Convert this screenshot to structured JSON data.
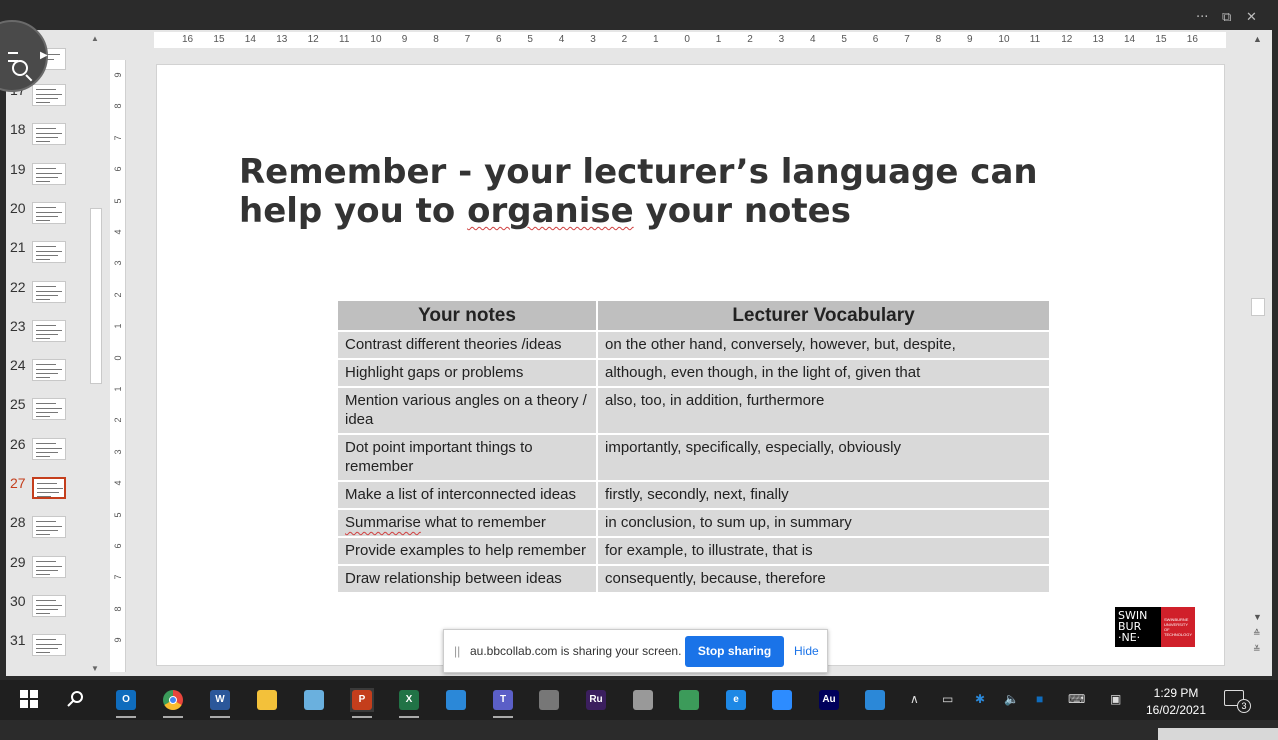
{
  "window": {
    "more": "···",
    "restore": "⧉",
    "close": "✕"
  },
  "thumbnails": [
    {
      "num": "17",
      "active": false
    },
    {
      "num": "18",
      "active": false
    },
    {
      "num": "19",
      "active": false
    },
    {
      "num": "20",
      "active": false
    },
    {
      "num": "21",
      "active": false
    },
    {
      "num": "22",
      "active": false
    },
    {
      "num": "23",
      "active": false
    },
    {
      "num": "24",
      "active": false
    },
    {
      "num": "25",
      "active": false
    },
    {
      "num": "26",
      "active": false
    },
    {
      "num": "27",
      "active": true
    },
    {
      "num": "28",
      "active": false
    },
    {
      "num": "29",
      "active": false
    },
    {
      "num": "30",
      "active": false
    },
    {
      "num": "31",
      "active": false
    }
  ],
  "ruler": {
    "horizontal": [
      "16",
      "15",
      "14",
      "13",
      "12",
      "11",
      "10",
      "9",
      "8",
      "7",
      "6",
      "5",
      "4",
      "3",
      "2",
      "1",
      "0",
      "1",
      "2",
      "3",
      "4",
      "5",
      "6",
      "7",
      "8",
      "9",
      "10",
      "11",
      "12",
      "13",
      "14",
      "15",
      "16"
    ],
    "vertical": [
      "9",
      "8",
      "7",
      "6",
      "5",
      "4",
      "3",
      "2",
      "1",
      "0",
      "1",
      "2",
      "3",
      "4",
      "5",
      "6",
      "7",
      "8",
      "9"
    ]
  },
  "slide": {
    "title_line1": "Remember - your lecturer’s language can",
    "title_line2_a": "help you to ",
    "title_line2_b": "organise",
    "title_line2_c": " your notes",
    "table": {
      "headers": [
        "Your notes",
        "Lecturer Vocabulary"
      ],
      "rows": [
        [
          "Contrast different theories /ideas",
          "on the other hand, conversely, however, but, despite,"
        ],
        [
          "Highlight gaps or problems",
          "although, even though, in the light of, given that"
        ],
        [
          "Mention various angles on a theory / idea",
          "also, too, in addition, furthermore"
        ],
        [
          "Dot point important things to remember",
          "importantly, specifically, especially, obviously"
        ],
        [
          "Make a list of interconnected ideas",
          "firstly, secondly, next, finally"
        ],
        [
          "Summarise what to remember",
          "in conclusion, to sum up, in summary"
        ],
        [
          "Provide examples to help remember",
          "for example, to illustrate, that is"
        ],
        [
          "Draw relationship between ideas",
          "consequently, because, therefore"
        ]
      ]
    },
    "logo": {
      "line1": "SWIN",
      "line2": "BUR",
      "line3": "·NE·",
      "tagline": "SWINBURNE UNIVERSITY OF TECHNOLOGY"
    }
  },
  "share_banner": {
    "grip": "||",
    "message": "au.bbcollab.com is sharing your screen.",
    "stop_label": "Stop sharing",
    "hide_label": "Hide"
  },
  "taskbar": {
    "icons": [
      {
        "name": "start-icon",
        "label": "",
        "color": "#ffffff"
      },
      {
        "name": "search-icon",
        "label": "",
        "color": "#ffffff"
      },
      {
        "name": "outlook-icon",
        "label": "O",
        "color": "#0f6cbd"
      },
      {
        "name": "chrome-icon",
        "label": "",
        "color": "#e8453c"
      },
      {
        "name": "word-icon",
        "label": "W",
        "color": "#2b579a"
      },
      {
        "name": "file-explorer-icon",
        "label": "",
        "color": "#f3c13a"
      },
      {
        "name": "paint-icon",
        "label": "",
        "color": "#6ab0de"
      },
      {
        "name": "powerpoint-icon",
        "label": "P",
        "color": "#c43e1c"
      },
      {
        "name": "excel-icon",
        "label": "X",
        "color": "#217346"
      },
      {
        "name": "files-icon",
        "label": "",
        "color": "#2b88d8"
      },
      {
        "name": "teams-icon",
        "label": "T",
        "color": "#5b5fc7"
      },
      {
        "name": "camera-icon",
        "label": "",
        "color": "#777777"
      },
      {
        "name": "rush-icon",
        "label": "Ru",
        "color": "#3b1f5e"
      },
      {
        "name": "recorder-icon",
        "label": "",
        "color": "#999999"
      },
      {
        "name": "network-icon",
        "label": "",
        "color": "#3c9b5a"
      },
      {
        "name": "edge-icon",
        "label": "e",
        "color": "#1e88e5"
      },
      {
        "name": "zoom-icon",
        "label": "",
        "color": "#2d8cff"
      },
      {
        "name": "audition-icon",
        "label": "Au",
        "color": "#00005b"
      },
      {
        "name": "photos-icon",
        "label": "",
        "color": "#2b88d8"
      }
    ],
    "time": "1:29 PM",
    "date": "16/02/2021",
    "notifications": "3"
  }
}
